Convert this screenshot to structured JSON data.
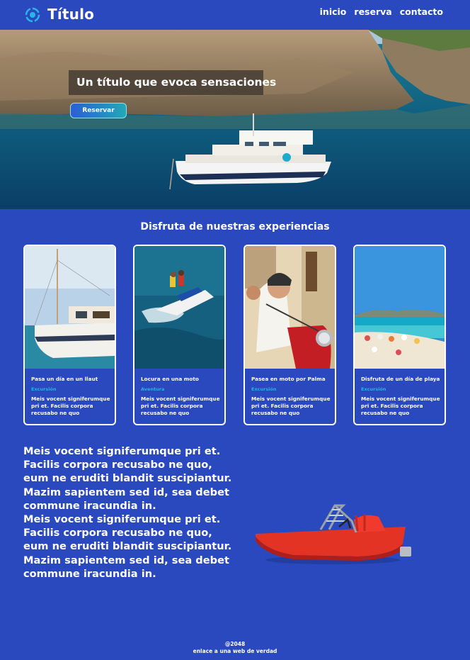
{
  "header": {
    "title": "Título",
    "nav": [
      "inicio",
      "reserva",
      "contacto"
    ]
  },
  "hero": {
    "title": "Un título que evoca sensaciones",
    "button": "Reservar"
  },
  "experiences": {
    "heading": "Disfruta de nuestras experiencias",
    "cards": [
      {
        "title": "Pasa un día en un llaut",
        "tag": "Excursión",
        "text": "Meis vocent signiferumque pri et. Facilis corpora recusabo ne quo"
      },
      {
        "title": "Locura en una moto",
        "tag": "Aventura",
        "text": "Meis vocent signiferumque pri et. Facilis corpora recusabo ne quo"
      },
      {
        "title": "Pasea en moto por Palma",
        "tag": "Excursión",
        "text": "Meis vocent signiferumque pri et. Facilis corpora recusabo ne quo"
      },
      {
        "title": "Disfruta de un día de playa",
        "tag": "Excursión",
        "text": "Meis vocent signiferumque pri et. Facilis corpora recusabo ne quo"
      }
    ]
  },
  "content": {
    "lines": [
      "Meis vocent signiferumque pri et.",
      "Facilis corpora recusabo ne quo,",
      "eum ne eruditi blandit suscipiantur.",
      "Mazim sapientem sed id, sea debet",
      "commune iracundia in.",
      "Meis vocent signiferumque pri et.",
      "Facilis corpora recusabo ne quo,",
      "eum ne eruditi blandit suscipiantur.",
      "Mazim sapientem sed id, sea debet",
      "commune iracundia in."
    ]
  },
  "footer": {
    "copyright": "@2048",
    "link": "enlace a una web de verdad"
  },
  "colors": {
    "background": "#2b49bf",
    "accent": "#2ab0e0",
    "button_start": "#2c5ed4",
    "button_end": "#21a9b8"
  }
}
